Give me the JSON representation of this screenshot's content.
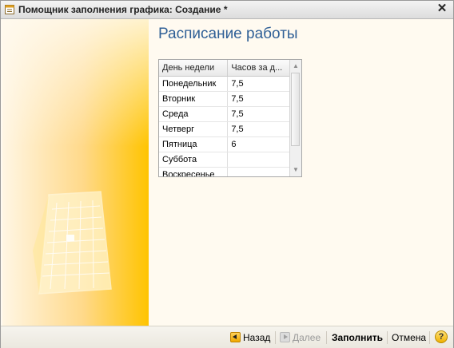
{
  "window": {
    "title": "Помощник заполнения графика: Создание *",
    "close_glyph": "✕"
  },
  "main": {
    "heading": "Расписание работы"
  },
  "table": {
    "columns": [
      "День недели",
      "Часов за д..."
    ],
    "rows": [
      {
        "day": "Понедельник",
        "hours": "7,5"
      },
      {
        "day": "Вторник",
        "hours": "7,5"
      },
      {
        "day": "Среда",
        "hours": "7,5"
      },
      {
        "day": "Четверг",
        "hours": "7,5"
      },
      {
        "day": "Пятница",
        "hours": "6"
      },
      {
        "day": "Суббота",
        "hours": ""
      },
      {
        "day": "Воскресенье",
        "hours": ""
      }
    ]
  },
  "footer": {
    "back_label": "Назад",
    "next_label": "Далее",
    "fill_label": "Заполнить",
    "cancel_label": "Отмена",
    "help_glyph": "?"
  },
  "icons": {
    "app": "wizard-icon",
    "close": "close-icon",
    "back": "arrow-left-icon",
    "next": "arrow-right-icon",
    "help": "help-icon",
    "scroll_up": "scroll-up-arrow-icon",
    "scroll_down": "scroll-down-arrow-icon",
    "illustration": "calendar-illustration-icon"
  },
  "colors": {
    "heading": "#2f5f96",
    "side_panel_start": "#fff6e4",
    "side_panel_end": "#ffc400",
    "window_bg": "#fffaf0"
  }
}
